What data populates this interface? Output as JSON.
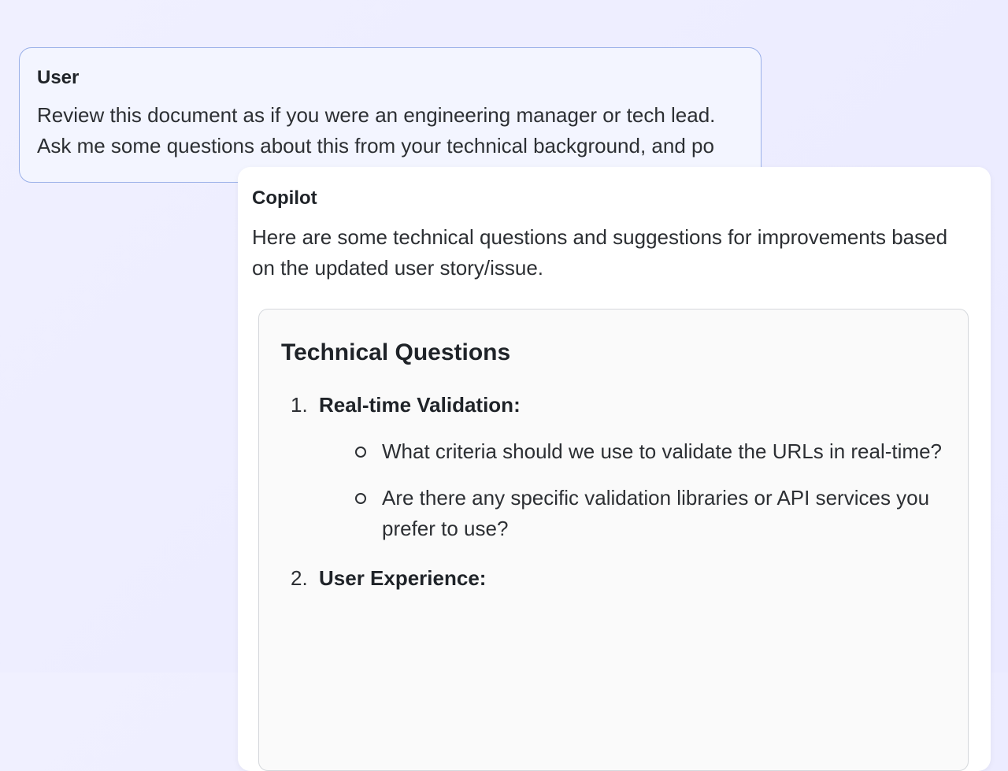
{
  "user_message": {
    "label": "User",
    "content": "Review this document as if you were an engineering manager or tech lead. Ask me some questions about this from your technical background, and po"
  },
  "copilot_message": {
    "label": "Copilot",
    "intro": "Here are some technical questions and suggestions for improvements based on the updated user story/issue.",
    "section_heading": "Technical Questions",
    "items": [
      {
        "title": "Real-time Validation:",
        "bullets": [
          "What criteria should we use to validate the URLs in real-time?",
          "Are there any specific validation libraries or API services you prefer to use?"
        ]
      },
      {
        "title": "User Experience:",
        "bullets": []
      }
    ]
  }
}
